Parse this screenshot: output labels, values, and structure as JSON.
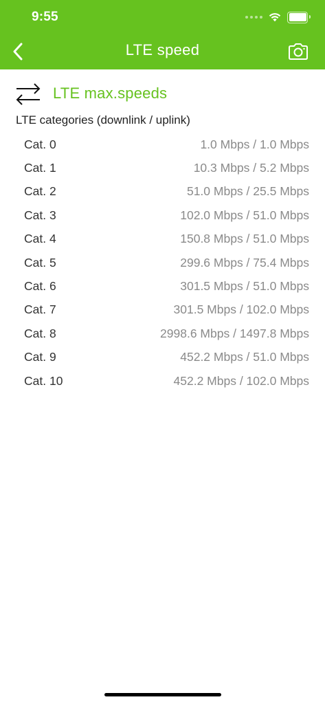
{
  "status_bar": {
    "time": "9:55",
    "icons": [
      "cellular-signal-icon",
      "wifi-icon",
      "battery-icon"
    ]
  },
  "nav": {
    "back_icon": "chevron-left-icon",
    "title": "LTE speed",
    "camera_icon": "camera-icon"
  },
  "colors": {
    "brand_green": "#66c21f",
    "value_gray": "#8a8a8a"
  },
  "section": {
    "icon": "swap-arrows-icon",
    "title": "LTE max.speeds",
    "subtitle": "LTE categories (downlink / uplink)"
  },
  "categories": [
    {
      "label": "Cat. 0",
      "value": "1.0 Mbps / 1.0 Mbps"
    },
    {
      "label": "Cat. 1",
      "value": "10.3 Mbps / 5.2 Mbps"
    },
    {
      "label": "Cat. 2",
      "value": "51.0 Mbps / 25.5 Mbps"
    },
    {
      "label": "Cat. 3",
      "value": "102.0 Mbps / 51.0 Mbps"
    },
    {
      "label": "Cat. 4",
      "value": "150.8 Mbps / 51.0 Mbps"
    },
    {
      "label": "Cat. 5",
      "value": "299.6 Mbps / 75.4 Mbps"
    },
    {
      "label": "Cat. 6",
      "value": "301.5 Mbps / 51.0 Mbps"
    },
    {
      "label": "Cat. 7",
      "value": "301.5 Mbps / 102.0 Mbps"
    },
    {
      "label": "Cat. 8",
      "value": "2998.6 Mbps / 1497.8 Mbps"
    },
    {
      "label": "Cat. 9",
      "value": "452.2 Mbps / 51.0 Mbps"
    },
    {
      "label": "Cat. 10",
      "value": "452.2 Mbps / 102.0 Mbps"
    }
  ]
}
